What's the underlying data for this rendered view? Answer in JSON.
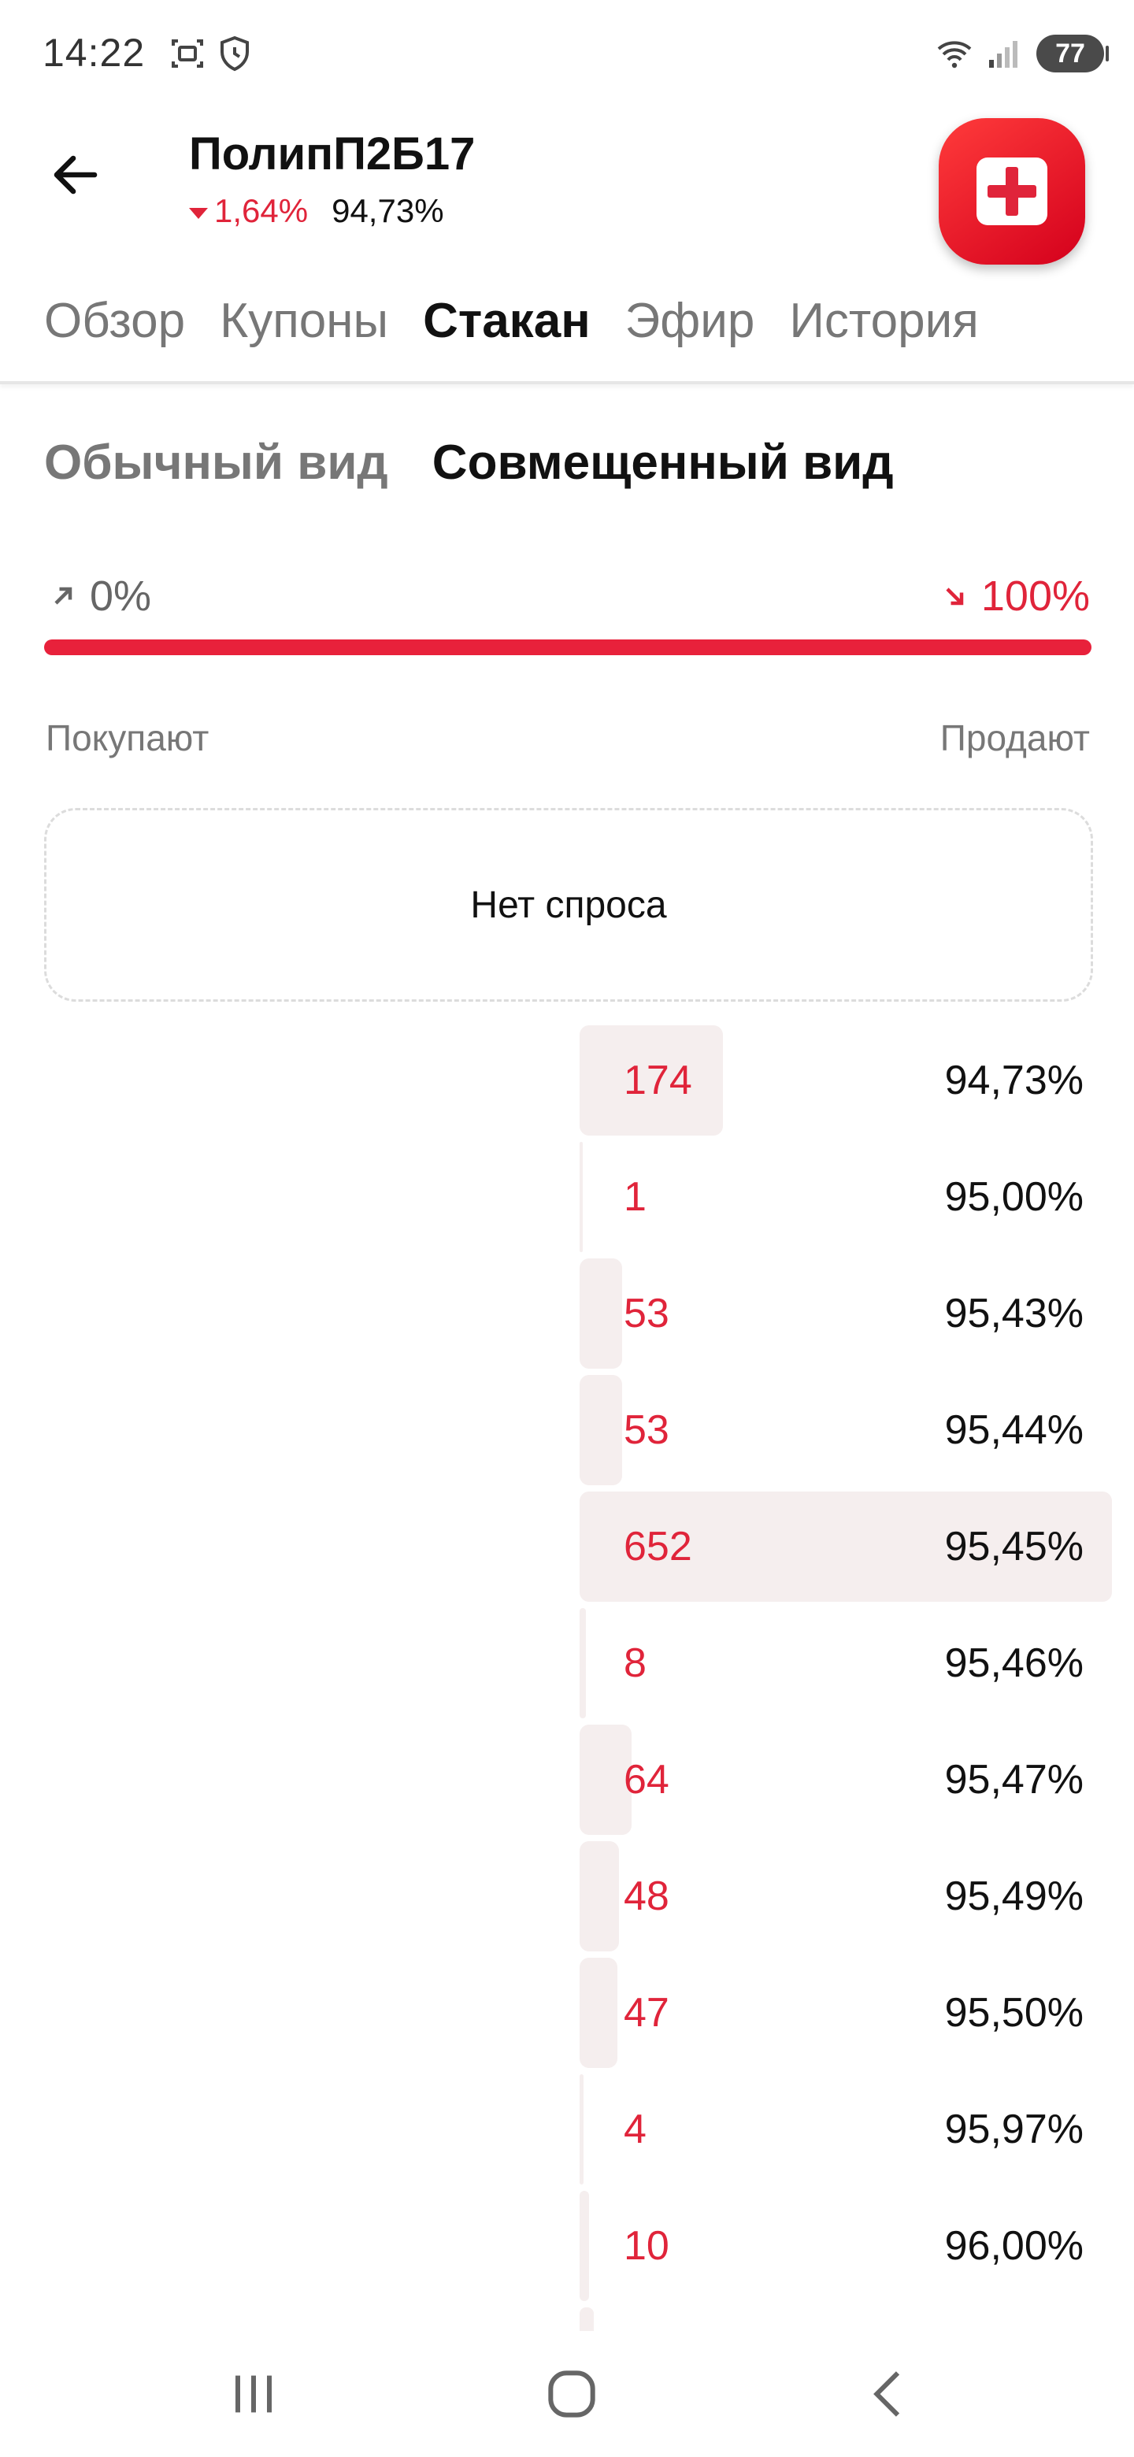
{
  "status_bar": {
    "time": "14:22",
    "battery": "77",
    "icons": [
      "screenshot-icon",
      "shield-clock-icon",
      "wifi-icon",
      "signal-icon"
    ]
  },
  "header": {
    "ticker": "ПолипП2Б17",
    "change": "1,64%",
    "price": "94,73%"
  },
  "tabs": [
    {
      "label": "Обзор",
      "active": false
    },
    {
      "label": "Купоны",
      "active": false
    },
    {
      "label": "Стакан",
      "active": true
    },
    {
      "label": "Эфир",
      "active": false
    },
    {
      "label": "История",
      "active": false
    }
  ],
  "views": [
    {
      "label": "Обычный вид",
      "active": false
    },
    {
      "label": "Совмещенный вид",
      "active": true
    }
  ],
  "ratio": {
    "buy_pct": "0%",
    "sell_pct": "100%",
    "sell_fraction": 1.0
  },
  "book": {
    "buy_label": "Покупают",
    "sell_label": "Продают",
    "no_demand": "Нет спроса",
    "asks": [
      {
        "qty": "174",
        "price": "94,73%"
      },
      {
        "qty": "1",
        "price": "95,00%"
      },
      {
        "qty": "53",
        "price": "95,43%"
      },
      {
        "qty": "53",
        "price": "95,44%"
      },
      {
        "qty": "652",
        "price": "95,45%"
      },
      {
        "qty": "8",
        "price": "95,46%"
      },
      {
        "qty": "64",
        "price": "95,47%"
      },
      {
        "qty": "48",
        "price": "95,49%"
      },
      {
        "qty": "47",
        "price": "95,50%"
      },
      {
        "qty": "4",
        "price": "95,97%"
      },
      {
        "qty": "10",
        "price": "96,00%"
      }
    ]
  },
  "colors": {
    "accent_red": "#e0243a",
    "bar_bg": "#f5eeee"
  }
}
